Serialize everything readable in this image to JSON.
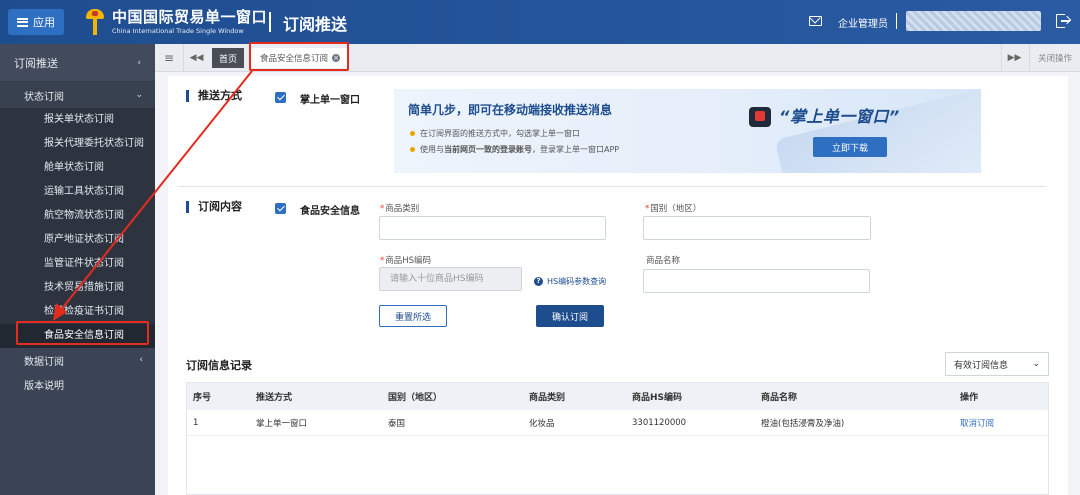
{
  "header": {
    "menu_label": "应用",
    "logo_cn": "中国国际贸易单一窗口",
    "logo_en": "China International Trade Single Window",
    "page_title": "订阅推送",
    "user_role": "企业管理员"
  },
  "sidebar": {
    "section": "订阅推送",
    "group": "状态订阅",
    "items": [
      {
        "label": "报关单状态订阅"
      },
      {
        "label": "报关代理委托状态订阅"
      },
      {
        "label": "舱单状态订阅"
      },
      {
        "label": "运输工具状态订阅"
      },
      {
        "label": "航空物流状态订阅"
      },
      {
        "label": "原产地证状态订阅"
      },
      {
        "label": "监管证件状态订阅"
      },
      {
        "label": "技术贸易措施订阅"
      },
      {
        "label": "检验检疫证书订阅"
      },
      {
        "label": "食品安全信息订阅"
      }
    ],
    "roots": [
      {
        "label": "数据订阅"
      },
      {
        "label": "版本说明"
      }
    ]
  },
  "tabs": {
    "home": "首页",
    "active": "食品安全信息订阅",
    "close_ops": "关闭操作"
  },
  "push_method": {
    "title": "推送方式",
    "option": "掌上单一窗口",
    "checked": true
  },
  "banner": {
    "headline": "简单几步，即可在移动端接收推送消息",
    "line1": "在订阅界面的推送方式中，勾选掌上单一窗口",
    "line2_a": "使用与",
    "line2_b": "当前网页一致的登录账号",
    "line2_c": "，登录掌上单一窗口APP",
    "app_name": "掌上单一窗口",
    "download": "立即下载"
  },
  "subscription": {
    "title": "订阅内容",
    "option": "食品安全信息",
    "checked": true,
    "fields": {
      "category_label": "商品类别",
      "country_label": "国别（地区）",
      "hs_label": "商品HS编码",
      "hs_placeholder": "请输入十位商品HS编码",
      "hs_help": "HS编码参数查询",
      "name_label": "商品名称"
    },
    "reset": "重置所选",
    "confirm": "确认订阅"
  },
  "records": {
    "title": "订阅信息记录",
    "filter": "有效订阅信息",
    "columns": [
      "序号",
      "推送方式",
      "国别（地区）",
      "商品类别",
      "商品HS编码",
      "商品名称",
      "操作"
    ],
    "rows": [
      {
        "no": "1",
        "method": "掌上单一窗口",
        "country": "泰国",
        "category": "化妆品",
        "hs": "3301120000",
        "name": "橙油(包括浸膏及净油)",
        "action": "取消订阅"
      }
    ]
  },
  "colors": {
    "header": "#25559b",
    "sidebar": "#3b4454",
    "accent": "#2f6fc1",
    "highlight": "#e52a1e"
  }
}
